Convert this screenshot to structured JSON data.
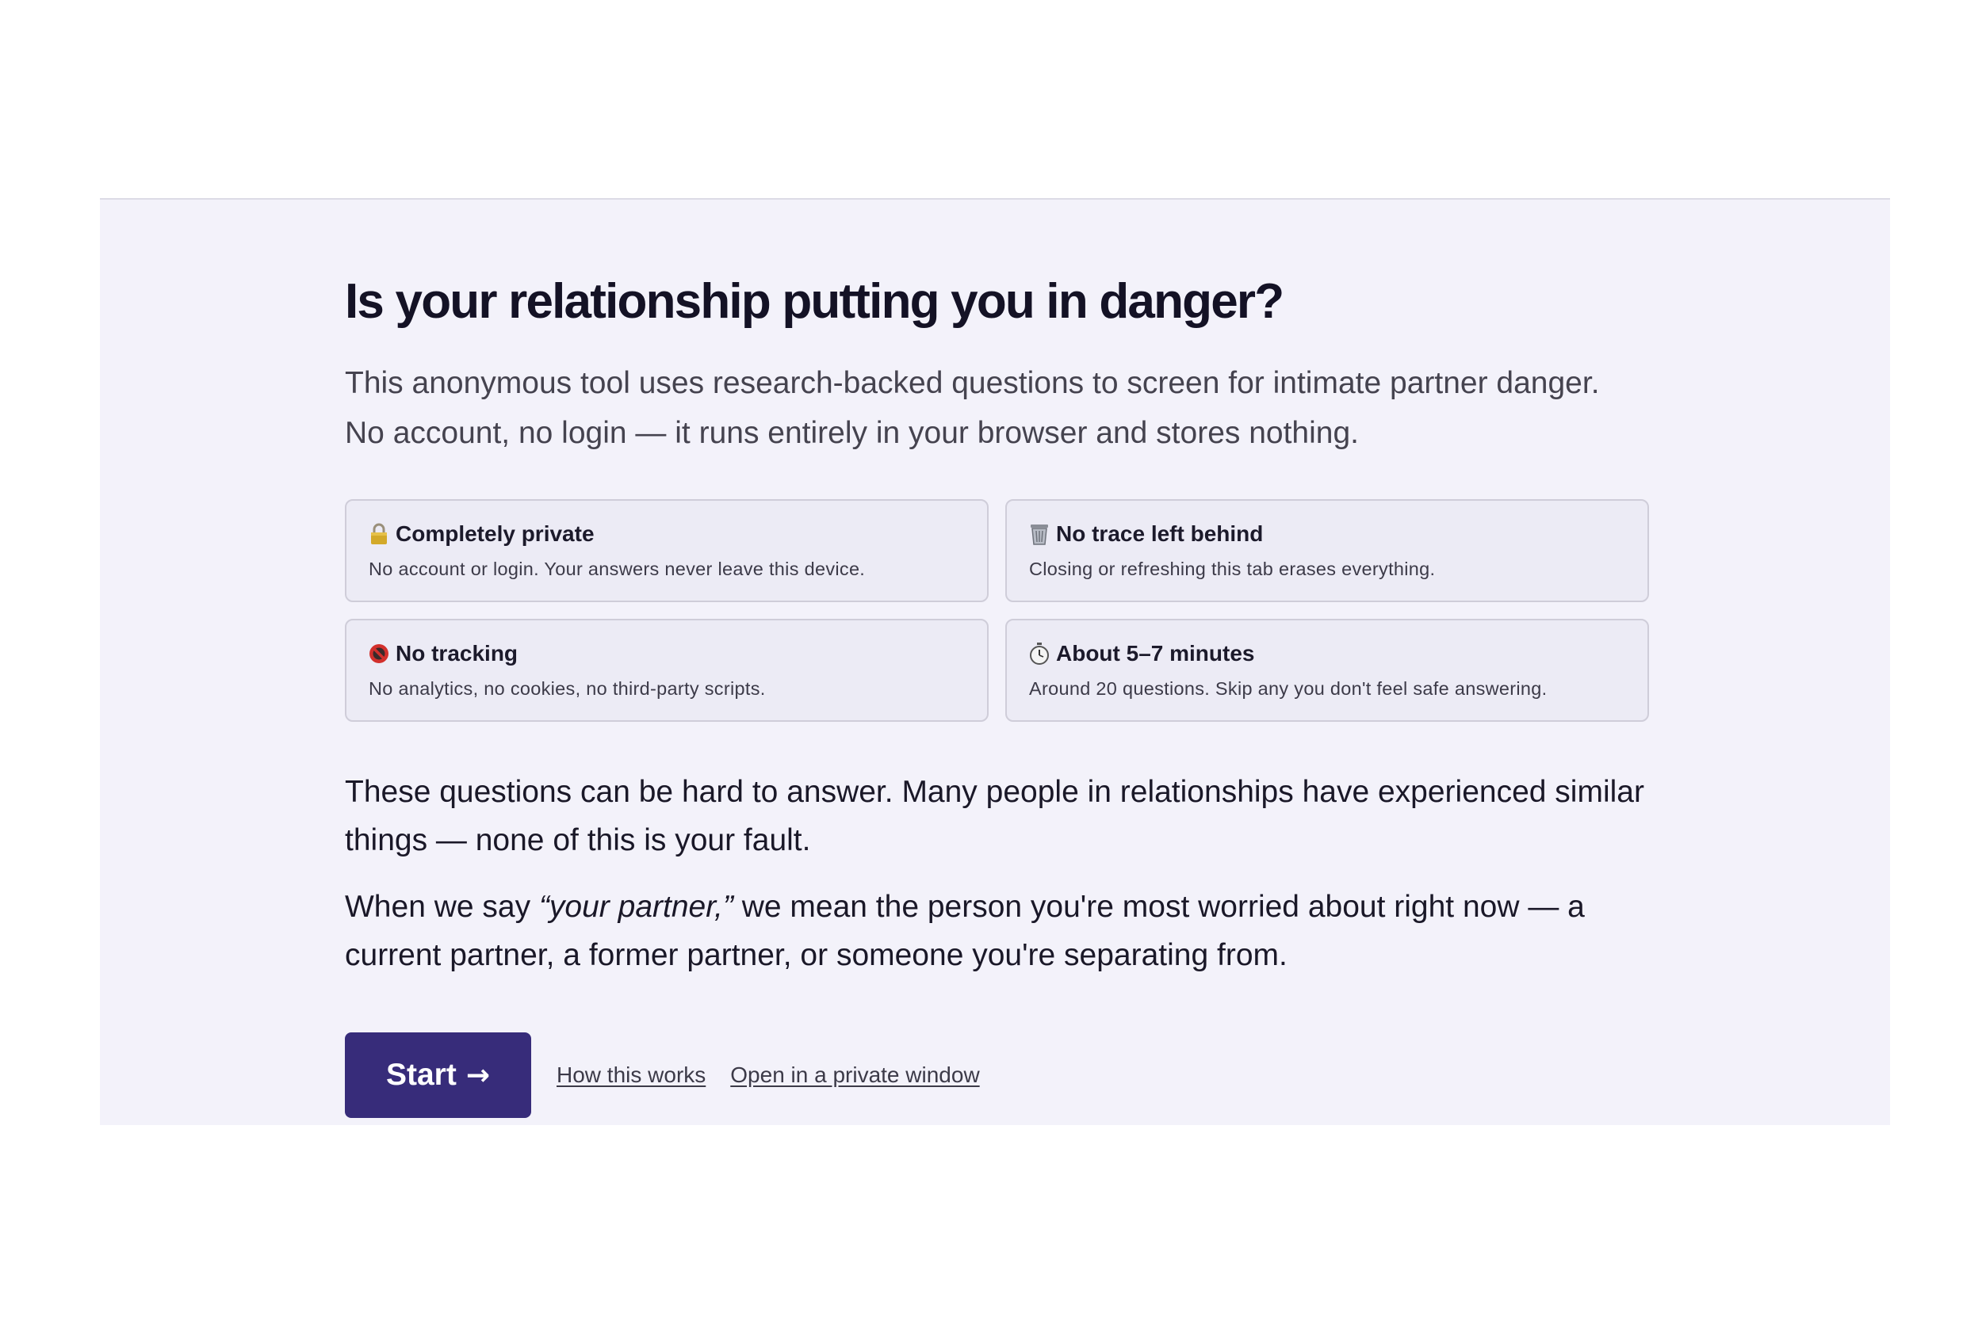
{
  "hero": {
    "title": "Is your relationship putting you in danger?",
    "lead": "This anonymous tool uses research-backed questions to screen for intimate partner danger. No account, no login — it runs entirely in your browser and stores nothing."
  },
  "cards": [
    {
      "icon": "lock-icon",
      "title": "Completely private",
      "desc": "No account or login. Your answers never leave this device."
    },
    {
      "icon": "trash-can-icon",
      "title": "No trace left behind",
      "desc": "Closing or refreshing this tab erases everything."
    },
    {
      "icon": "no-tracking-icon",
      "title": "No tracking",
      "desc": "No analytics, no cookies, no third-party scripts."
    },
    {
      "icon": "stopwatch-icon",
      "title": "About 5–7 minutes",
      "desc": "Around 20 questions. Skip any you don't feel safe answering."
    }
  ],
  "body": {
    "p1": "These questions can be hard to answer. Many people in relationships have experienced similar things — none of this is your fault.",
    "p2_before": "When we say ",
    "p2_em": "“your partner,”",
    "p2_after": " we mean the person you're most worried about right now — a current partner, a former partner, or someone you're separating from."
  },
  "actions": {
    "start_label": "Start",
    "start_arrow": "→",
    "how_link": "How this works",
    "private_link": "Open in a private window"
  },
  "colors": {
    "panel_bg": "#f3f2fa",
    "card_bg": "#ecebf5",
    "button_bg": "#372c7a",
    "title_text": "#141225"
  }
}
